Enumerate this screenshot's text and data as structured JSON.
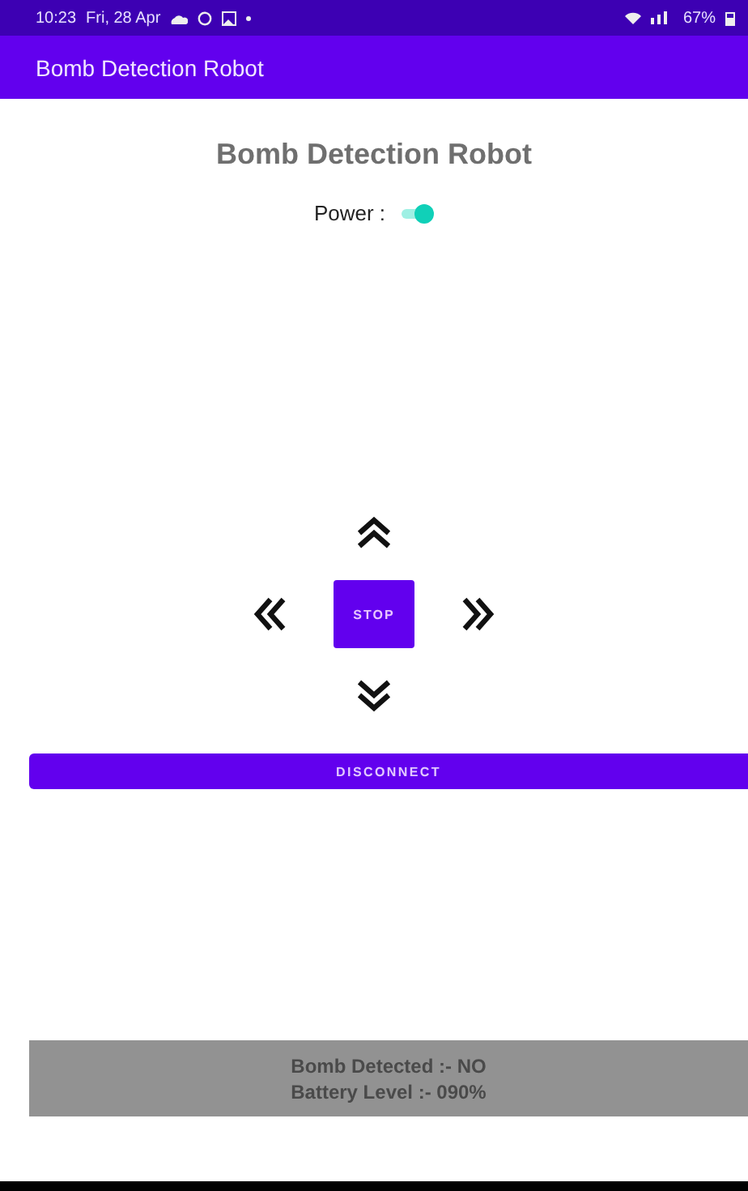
{
  "status_bar": {
    "time": "10:23",
    "date": "Fri, 28 Apr",
    "battery": "67%"
  },
  "app_bar": {
    "title": "Bomb Detection Robot"
  },
  "heading": "Bomb Detection Robot",
  "power": {
    "label": "Power :",
    "on": true
  },
  "controls": {
    "stop": "STOP"
  },
  "disconnect": "DISCONNECT",
  "status_panel": {
    "lines": [
      "Bomb Detected :- NO",
      "Battery Level :- 090%"
    ]
  }
}
